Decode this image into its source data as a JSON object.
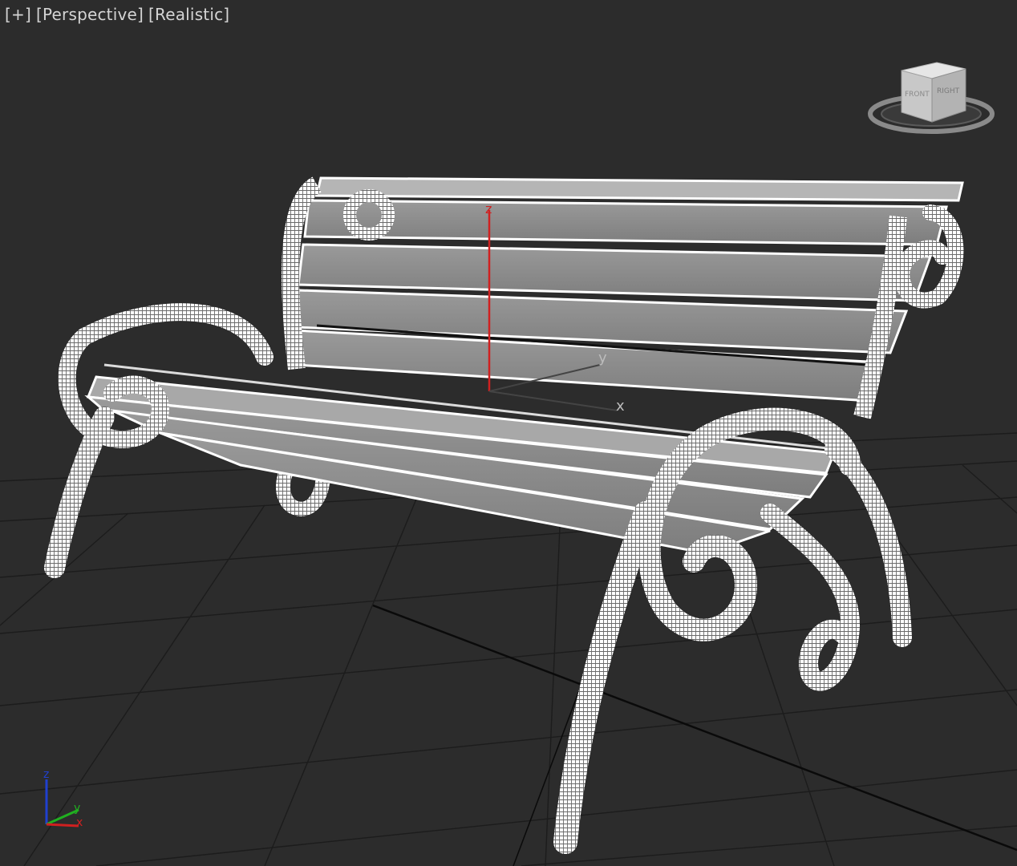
{
  "viewport": {
    "label_items": [
      "[+]",
      "[Perspective]",
      "[Realistic]"
    ]
  },
  "viewcube": {
    "face_front": "FRONT",
    "face_right": "RIGHT"
  },
  "gizmo": {
    "z_label": "z",
    "y_label": "y",
    "x_label": "x"
  },
  "corner_axis": {
    "z_label": "z",
    "y_label": "y",
    "x_label": "x"
  },
  "colors": {
    "background": "#2c2c2c",
    "grid_line": "#1f1f1f",
    "grid_major": "#0c0c0c",
    "wire": "#ffffff",
    "slat_fill": "#8a8a8a",
    "axis_z": "#d02020",
    "axis_x": "#d02020",
    "axis_y": "#20b020",
    "axis_z_blue": "#2040d0"
  }
}
